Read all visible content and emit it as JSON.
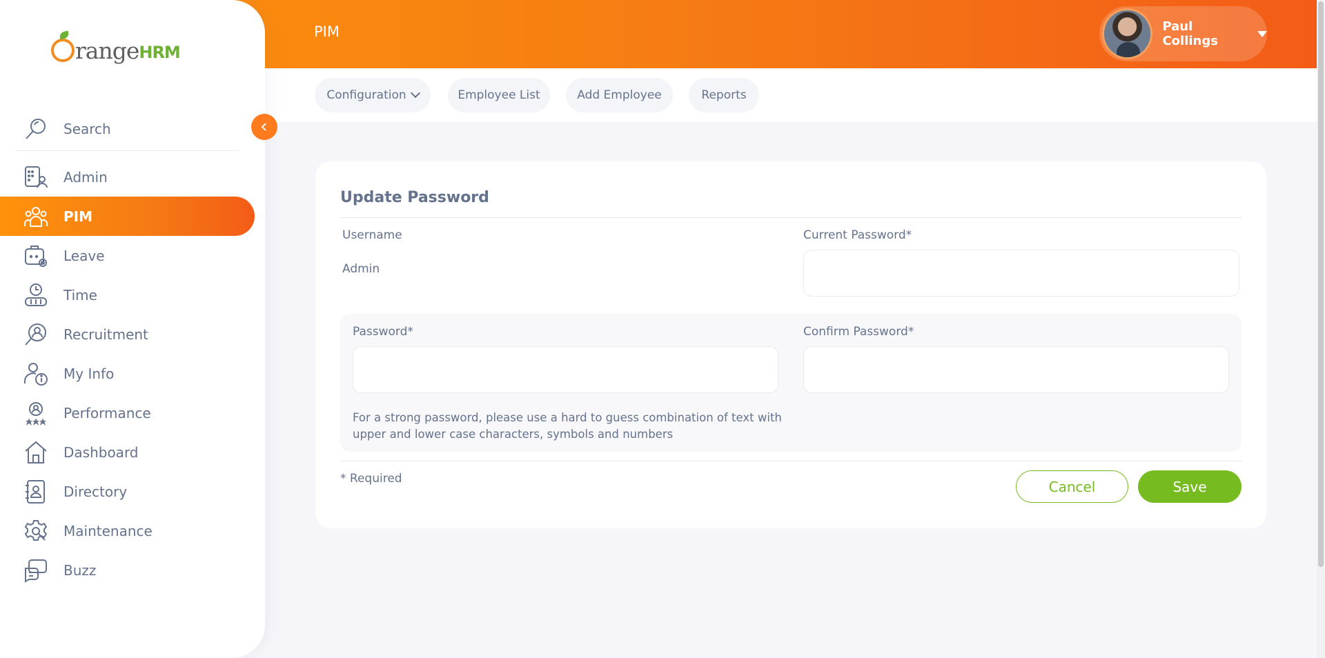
{
  "brand": {
    "logo_text": "OrangeHRM",
    "word": "range",
    "hrm": "HRM"
  },
  "sidebar": {
    "search_label": "Search",
    "items": [
      {
        "label": "Admin",
        "icon": "admin-icon",
        "active": false
      },
      {
        "label": "PIM",
        "icon": "pim-icon",
        "active": true
      },
      {
        "label": "Leave",
        "icon": "leave-icon",
        "active": false
      },
      {
        "label": "Time",
        "icon": "time-icon",
        "active": false
      },
      {
        "label": "Recruitment",
        "icon": "recruitment-icon",
        "active": false
      },
      {
        "label": "My Info",
        "icon": "my-info-icon",
        "active": false
      },
      {
        "label": "Performance",
        "icon": "performance-icon",
        "active": false
      },
      {
        "label": "Dashboard",
        "icon": "dashboard-icon",
        "active": false
      },
      {
        "label": "Directory",
        "icon": "directory-icon",
        "active": false
      },
      {
        "label": "Maintenance",
        "icon": "maintenance-icon",
        "active": false
      },
      {
        "label": "Buzz",
        "icon": "buzz-icon",
        "active": false
      }
    ]
  },
  "header": {
    "title": "PIM",
    "user_name": "Paul Collings"
  },
  "subnav": {
    "tabs": [
      {
        "label": "Configuration",
        "has_dropdown": true
      },
      {
        "label": "Employee List",
        "has_dropdown": false
      },
      {
        "label": "Add Employee",
        "has_dropdown": false
      },
      {
        "label": "Reports",
        "has_dropdown": false
      }
    ]
  },
  "form": {
    "title": "Update Password",
    "username_label": "Username",
    "username_value": "Admin",
    "current_password_label": "Current Password*",
    "current_password_value": "",
    "password_label": "Password*",
    "password_value": "",
    "confirm_password_label": "Confirm Password*",
    "confirm_password_value": "",
    "hint": "For a strong password, please use a hard to guess combination of text with upper and lower case characters, symbols and numbers",
    "required_note": "* Required",
    "cancel_label": "Cancel",
    "save_label": "Save"
  },
  "colors": {
    "accent_orange": "#ff7b1d",
    "header_gradient_start": "#ff920b",
    "header_gradient_end": "#f35c17",
    "success_green": "#76bc21",
    "text_muted": "#64728c"
  }
}
